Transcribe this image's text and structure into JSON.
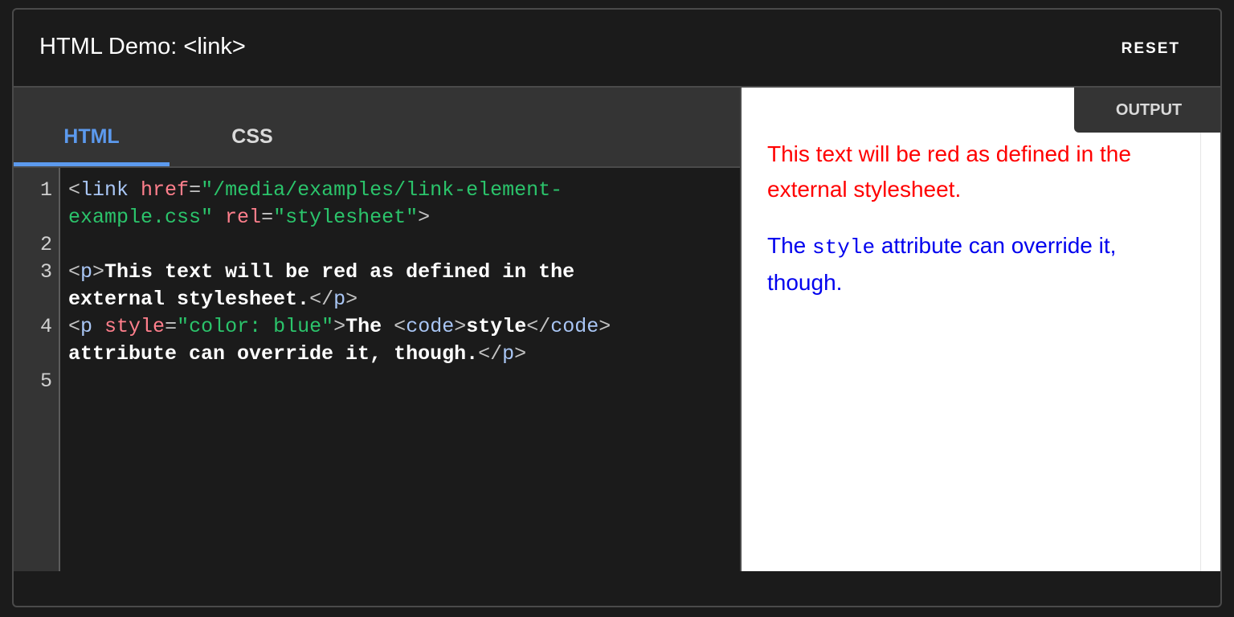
{
  "header": {
    "title": "HTML Demo: <link>",
    "reset_label": "RESET"
  },
  "editor": {
    "tabs": [
      {
        "label": "HTML",
        "active": true
      },
      {
        "label": "CSS",
        "active": false
      }
    ],
    "line_numbers": [
      "1",
      "2",
      "3",
      "4",
      "5"
    ],
    "code": {
      "l1a": {
        "lt": "<",
        "tag": "link",
        "attr1": "href",
        "eq1": "=",
        "str1": "\"/media/examples/link-element-"
      },
      "l1b": {
        "str1": "example.css\"",
        "attr2": "rel",
        "eq2": "=",
        "str2": "\"stylesheet\"",
        "gt": ">"
      },
      "l3a": {
        "lt": "<",
        "tag": "p",
        "gt": ">",
        "text": "This text will be red as defined in the"
      },
      "l3b": {
        "text": "external stylesheet.",
        "lt": "</",
        "tag": "p",
        "gt": ">"
      },
      "l4a": {
        "lt": "<",
        "tag": "p",
        "attr": "style",
        "eq": "=",
        "str": "\"color: blue\"",
        "gt": ">",
        "text1": "The",
        "lt2": "<",
        "tag2": "code",
        "gt2": ">",
        "text2": "style",
        "lt3": "</",
        "tag3": "code",
        "gt3": ">"
      },
      "l4b": {
        "text": "attribute can override it, though.",
        "lt": "</",
        "tag": "p",
        "gt": ">"
      }
    },
    "colors": {
      "tag": "#a9c6f5",
      "attribute": "#ff7f8c",
      "string": "#2bc46b",
      "active_tab": "#5c9aee"
    }
  },
  "output": {
    "label": "OUTPUT",
    "paragraph1": "This text will be red as defined in the external stylesheet.",
    "paragraph2_before": "The ",
    "paragraph2_code": "style",
    "paragraph2_after": " attribute can override it, though.",
    "colors": {
      "paragraph1": "#ff0000",
      "paragraph2": "#0000ee"
    }
  }
}
